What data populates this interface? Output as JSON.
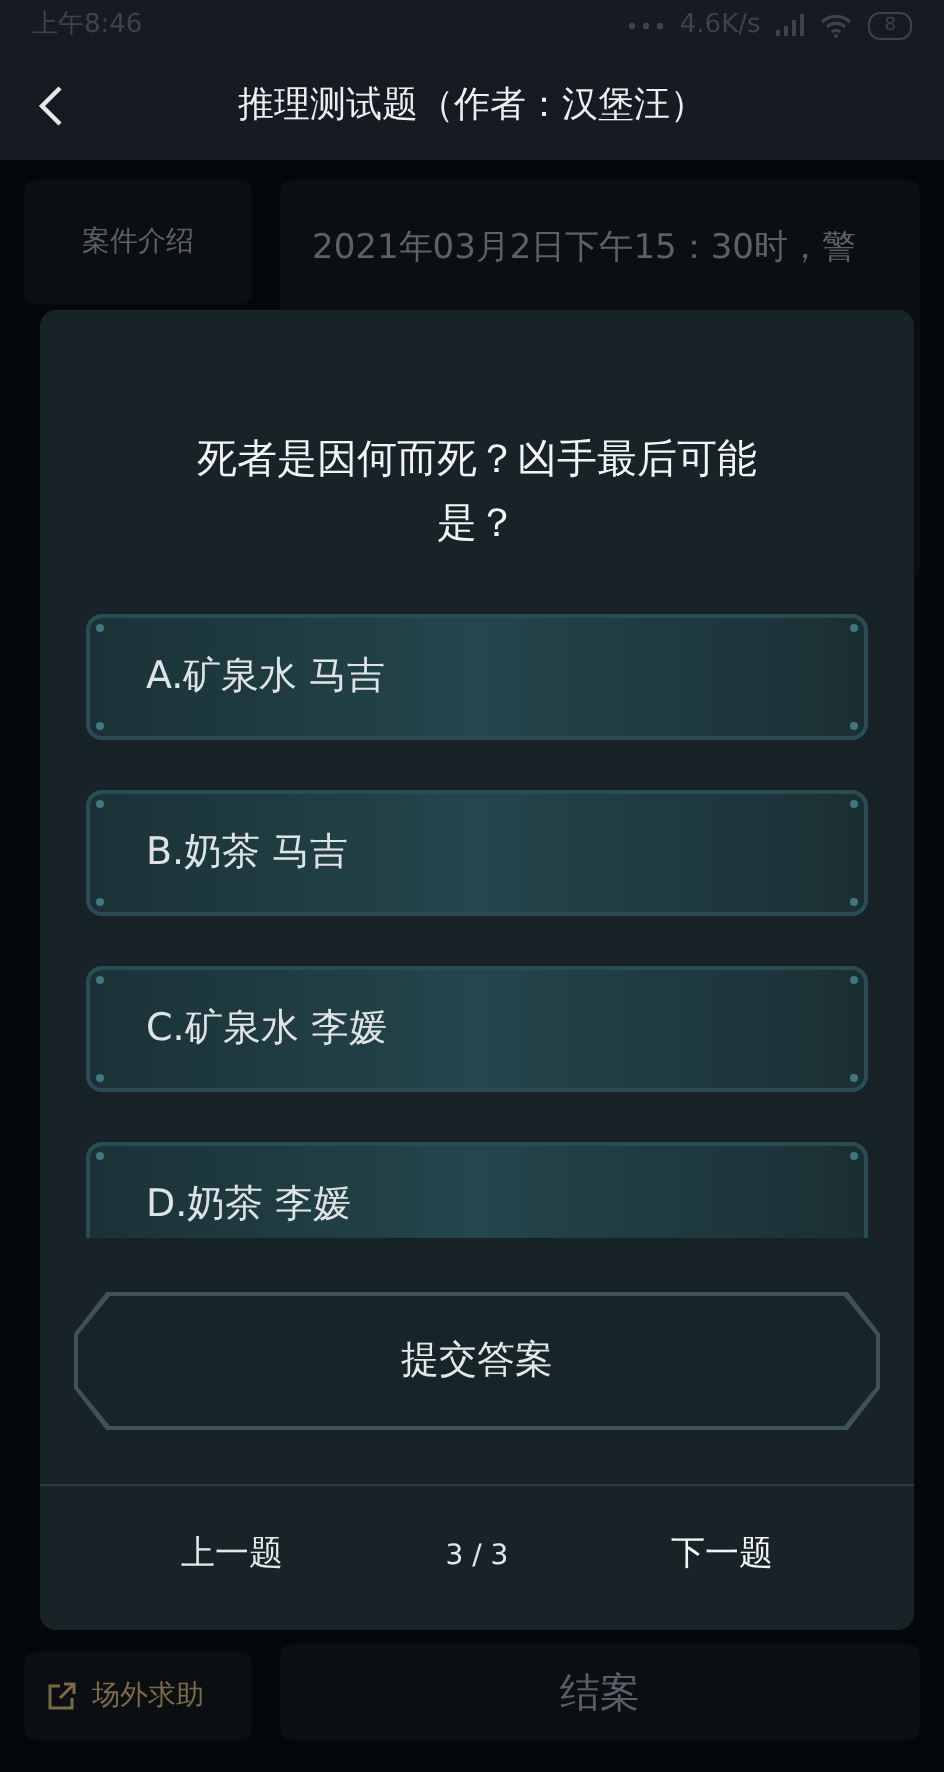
{
  "status_bar": {
    "time": "上午8:46",
    "speed": "4.6K/s",
    "battery": "8"
  },
  "header": {
    "title": "推理测试题（作者：汉堡汪）"
  },
  "background": {
    "tab": "案件介绍",
    "case_text": "2021年03月2日下午15：30时，警",
    "help": "场外求助",
    "close_case": "结案"
  },
  "dialog": {
    "question": "死者是因何而死？凶手最后可能是？",
    "options": [
      {
        "label": "A.矿泉水 马吉",
        "selected": false
      },
      {
        "label": "B.奶茶 马吉",
        "selected": false
      },
      {
        "label": "C.矿泉水 李媛",
        "selected": false
      },
      {
        "label": "D.奶茶 李媛",
        "selected": false
      }
    ],
    "submit": "提交答案",
    "prev": "上一题",
    "page": "3 / 3",
    "next": "下一题"
  }
}
